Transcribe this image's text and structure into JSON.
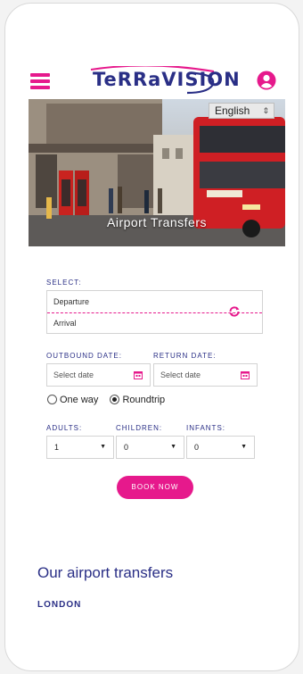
{
  "header": {
    "logo_text": "TeRRaVISION",
    "language": "English"
  },
  "hero": {
    "caption": "Airport Transfers"
  },
  "form": {
    "select_label": "SELECT:",
    "departure_placeholder": "Departure",
    "arrival_placeholder": "Arrival",
    "outbound_label": "OUTBOUND DATE:",
    "return_label": "RETURN DATE:",
    "outbound_placeholder": "Select date",
    "return_placeholder": "Select date",
    "trip_options": [
      "One way",
      "Roundtrip"
    ],
    "trip_selected": "Roundtrip",
    "adults_label": "ADULTS:",
    "children_label": "CHILDREN:",
    "infants_label": "INFANTS:",
    "adults_value": "1",
    "children_value": "0",
    "infants_value": "0",
    "book_label": "BOOK NOW"
  },
  "transfers": {
    "title": "Our airport transfers",
    "city": "LONDON"
  },
  "colors": {
    "accent": "#e6198c",
    "brand": "#2a2f86"
  }
}
